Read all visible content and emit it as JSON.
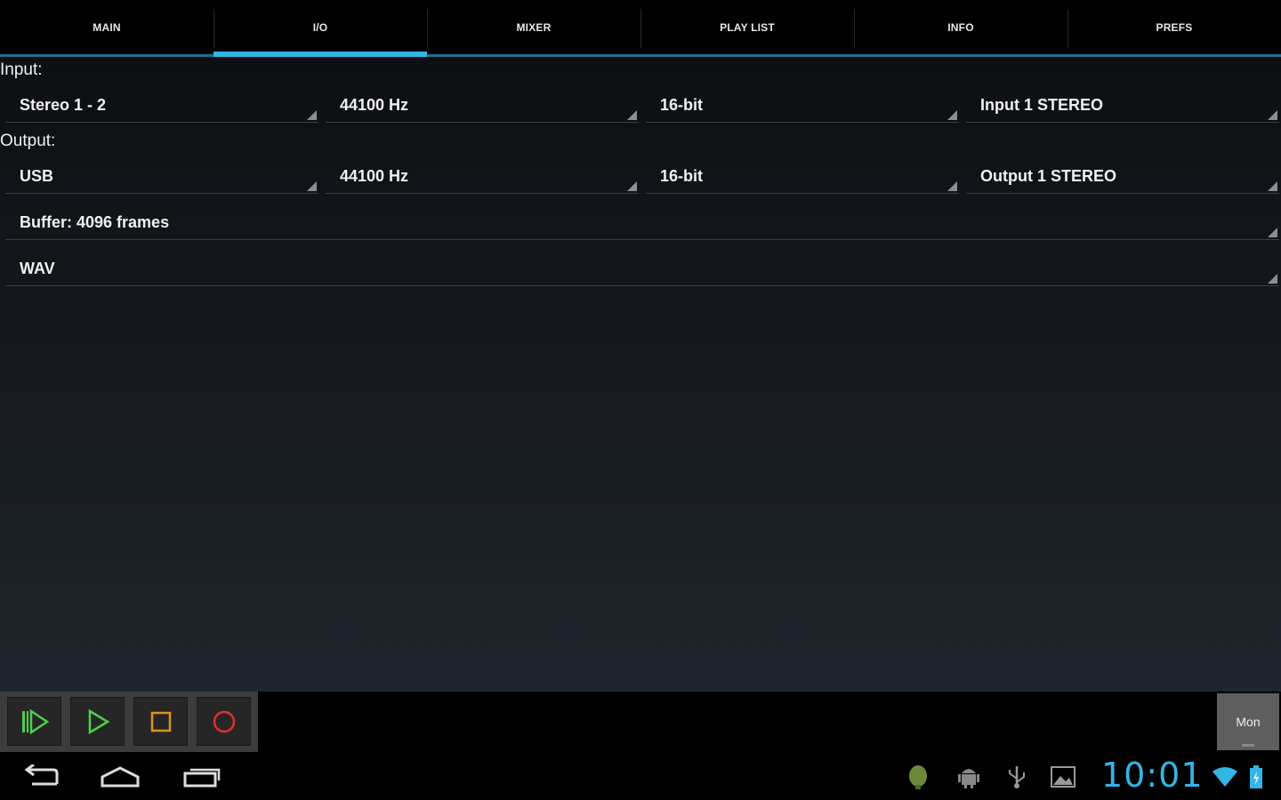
{
  "tabs": [
    {
      "label": "MAIN"
    },
    {
      "label": "I/O"
    },
    {
      "label": "MIXER"
    },
    {
      "label": "PLAY LIST"
    },
    {
      "label": "INFO"
    },
    {
      "label": "PREFS"
    }
  ],
  "active_tab": "I/O",
  "io": {
    "input_label": "Input:",
    "input": {
      "device": "Stereo 1 - 2",
      "sample_rate": "44100 Hz",
      "bit_depth": "16-bit",
      "channel": "Input 1 STEREO"
    },
    "output_label": "Output:",
    "output": {
      "device": "USB",
      "sample_rate": "44100 Hz",
      "bit_depth": "16-bit",
      "channel": "Output 1 STEREO"
    },
    "buffer": "Buffer: 4096 frames",
    "format": "WAV"
  },
  "transport": {
    "buttons": [
      "play-from-start-icon",
      "play-icon",
      "stop-icon",
      "record-icon"
    ],
    "mon_label": "Mon"
  },
  "system": {
    "clock": "10:01",
    "accent_color": "#33b5e5"
  }
}
